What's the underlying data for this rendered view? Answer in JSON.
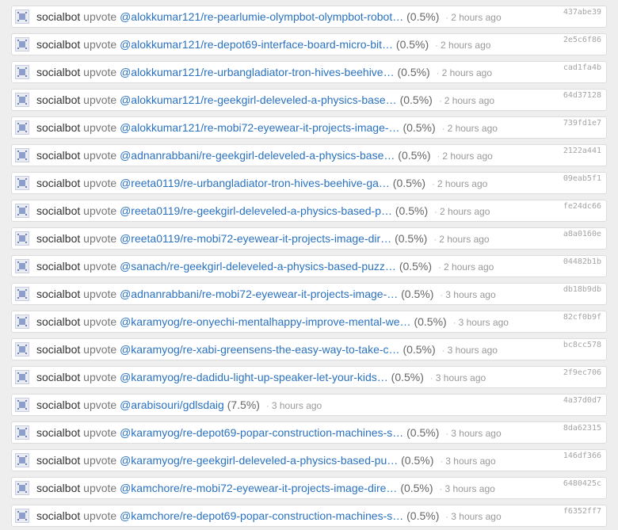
{
  "feed": {
    "items": [
      {
        "user": "socialbot",
        "action": "upvote",
        "target": "@alokkumar121/re-pearlumie-olympbot-olympbot-robot…",
        "percent": "(0.5%)",
        "separator": "·",
        "time": "2 hours ago",
        "tx": "437abe39"
      },
      {
        "user": "socialbot",
        "action": "upvote",
        "target": "@alokkumar121/re-depot69-interface-board-micro-bit…",
        "percent": "(0.5%)",
        "separator": "·",
        "time": "2 hours ago",
        "tx": "2e5c6f86"
      },
      {
        "user": "socialbot",
        "action": "upvote",
        "target": "@alokkumar121/re-urbangladiator-tron-hives-beehive…",
        "percent": "(0.5%)",
        "separator": "·",
        "time": "2 hours ago",
        "tx": "cad1fa4b"
      },
      {
        "user": "socialbot",
        "action": "upvote",
        "target": "@alokkumar121/re-geekgirl-deleveled-a-physics-base…",
        "percent": "(0.5%)",
        "separator": "·",
        "time": "2 hours ago",
        "tx": "64d37128"
      },
      {
        "user": "socialbot",
        "action": "upvote",
        "target": "@alokkumar121/re-mobi72-eyewear-it-projects-image-…",
        "percent": "(0.5%)",
        "separator": "·",
        "time": "2 hours ago",
        "tx": "739fd1e7"
      },
      {
        "user": "socialbot",
        "action": "upvote",
        "target": "@adnanrabbani/re-geekgirl-deleveled-a-physics-base…",
        "percent": "(0.5%)",
        "separator": "·",
        "time": "2 hours ago",
        "tx": "2122a441"
      },
      {
        "user": "socialbot",
        "action": "upvote",
        "target": "@reeta0119/re-urbangladiator-tron-hives-beehive-ga…",
        "percent": "(0.5%)",
        "separator": "·",
        "time": "2 hours ago",
        "tx": "09eab5f1"
      },
      {
        "user": "socialbot",
        "action": "upvote",
        "target": "@reeta0119/re-geekgirl-deleveled-a-physics-based-p…",
        "percent": "(0.5%)",
        "separator": "·",
        "time": "2 hours ago",
        "tx": "fe24dc66"
      },
      {
        "user": "socialbot",
        "action": "upvote",
        "target": "@reeta0119/re-mobi72-eyewear-it-projects-image-dir…",
        "percent": "(0.5%)",
        "separator": "·",
        "time": "2 hours ago",
        "tx": "a8a0160e"
      },
      {
        "user": "socialbot",
        "action": "upvote",
        "target": "@sanach/re-geekgirl-deleveled-a-physics-based-puzz…",
        "percent": "(0.5%)",
        "separator": "·",
        "time": "2 hours ago",
        "tx": "04482b1b"
      },
      {
        "user": "socialbot",
        "action": "upvote",
        "target": "@adnanrabbani/re-mobi72-eyewear-it-projects-image-…",
        "percent": "(0.5%)",
        "separator": "·",
        "time": "3 hours ago",
        "tx": "db18b9db"
      },
      {
        "user": "socialbot",
        "action": "upvote",
        "target": "@karamyog/re-onyechi-mentalhappy-improve-mental-we…",
        "percent": "(0.5%)",
        "separator": "·",
        "time": "3 hours ago",
        "tx": "82cf0b9f"
      },
      {
        "user": "socialbot",
        "action": "upvote",
        "target": "@karamyog/re-xabi-greensens-the-easy-way-to-take-c…",
        "percent": "(0.5%)",
        "separator": "·",
        "time": "3 hours ago",
        "tx": "bc8cc578"
      },
      {
        "user": "socialbot",
        "action": "upvote",
        "target": "@karamyog/re-dadidu-light-up-speaker-let-your-kids…",
        "percent": "(0.5%)",
        "separator": "·",
        "time": "3 hours ago",
        "tx": "2f9ec706"
      },
      {
        "user": "socialbot",
        "action": "upvote",
        "target": "@arabisouri/gdlsdaig",
        "percent": "(7.5%)",
        "separator": "·",
        "time": "3 hours ago",
        "tx": "4a37d0d7"
      },
      {
        "user": "socialbot",
        "action": "upvote",
        "target": "@karamyog/re-depot69-popar-construction-machines-s…",
        "percent": "(0.5%)",
        "separator": "·",
        "time": "3 hours ago",
        "tx": "8da62315"
      },
      {
        "user": "socialbot",
        "action": "upvote",
        "target": "@karamyog/re-geekgirl-deleveled-a-physics-based-pu…",
        "percent": "(0.5%)",
        "separator": "·",
        "time": "3 hours ago",
        "tx": "146df366"
      },
      {
        "user": "socialbot",
        "action": "upvote",
        "target": "@kamchore/re-mobi72-eyewear-it-projects-image-dire…",
        "percent": "(0.5%)",
        "separator": "·",
        "time": "3 hours ago",
        "tx": "6480425c"
      },
      {
        "user": "socialbot",
        "action": "upvote",
        "target": "@kamchore/re-depot69-popar-construction-machines-s…",
        "percent": "(0.5%)",
        "separator": "·",
        "time": "3 hours ago",
        "tx": "f6352ff7"
      }
    ]
  }
}
